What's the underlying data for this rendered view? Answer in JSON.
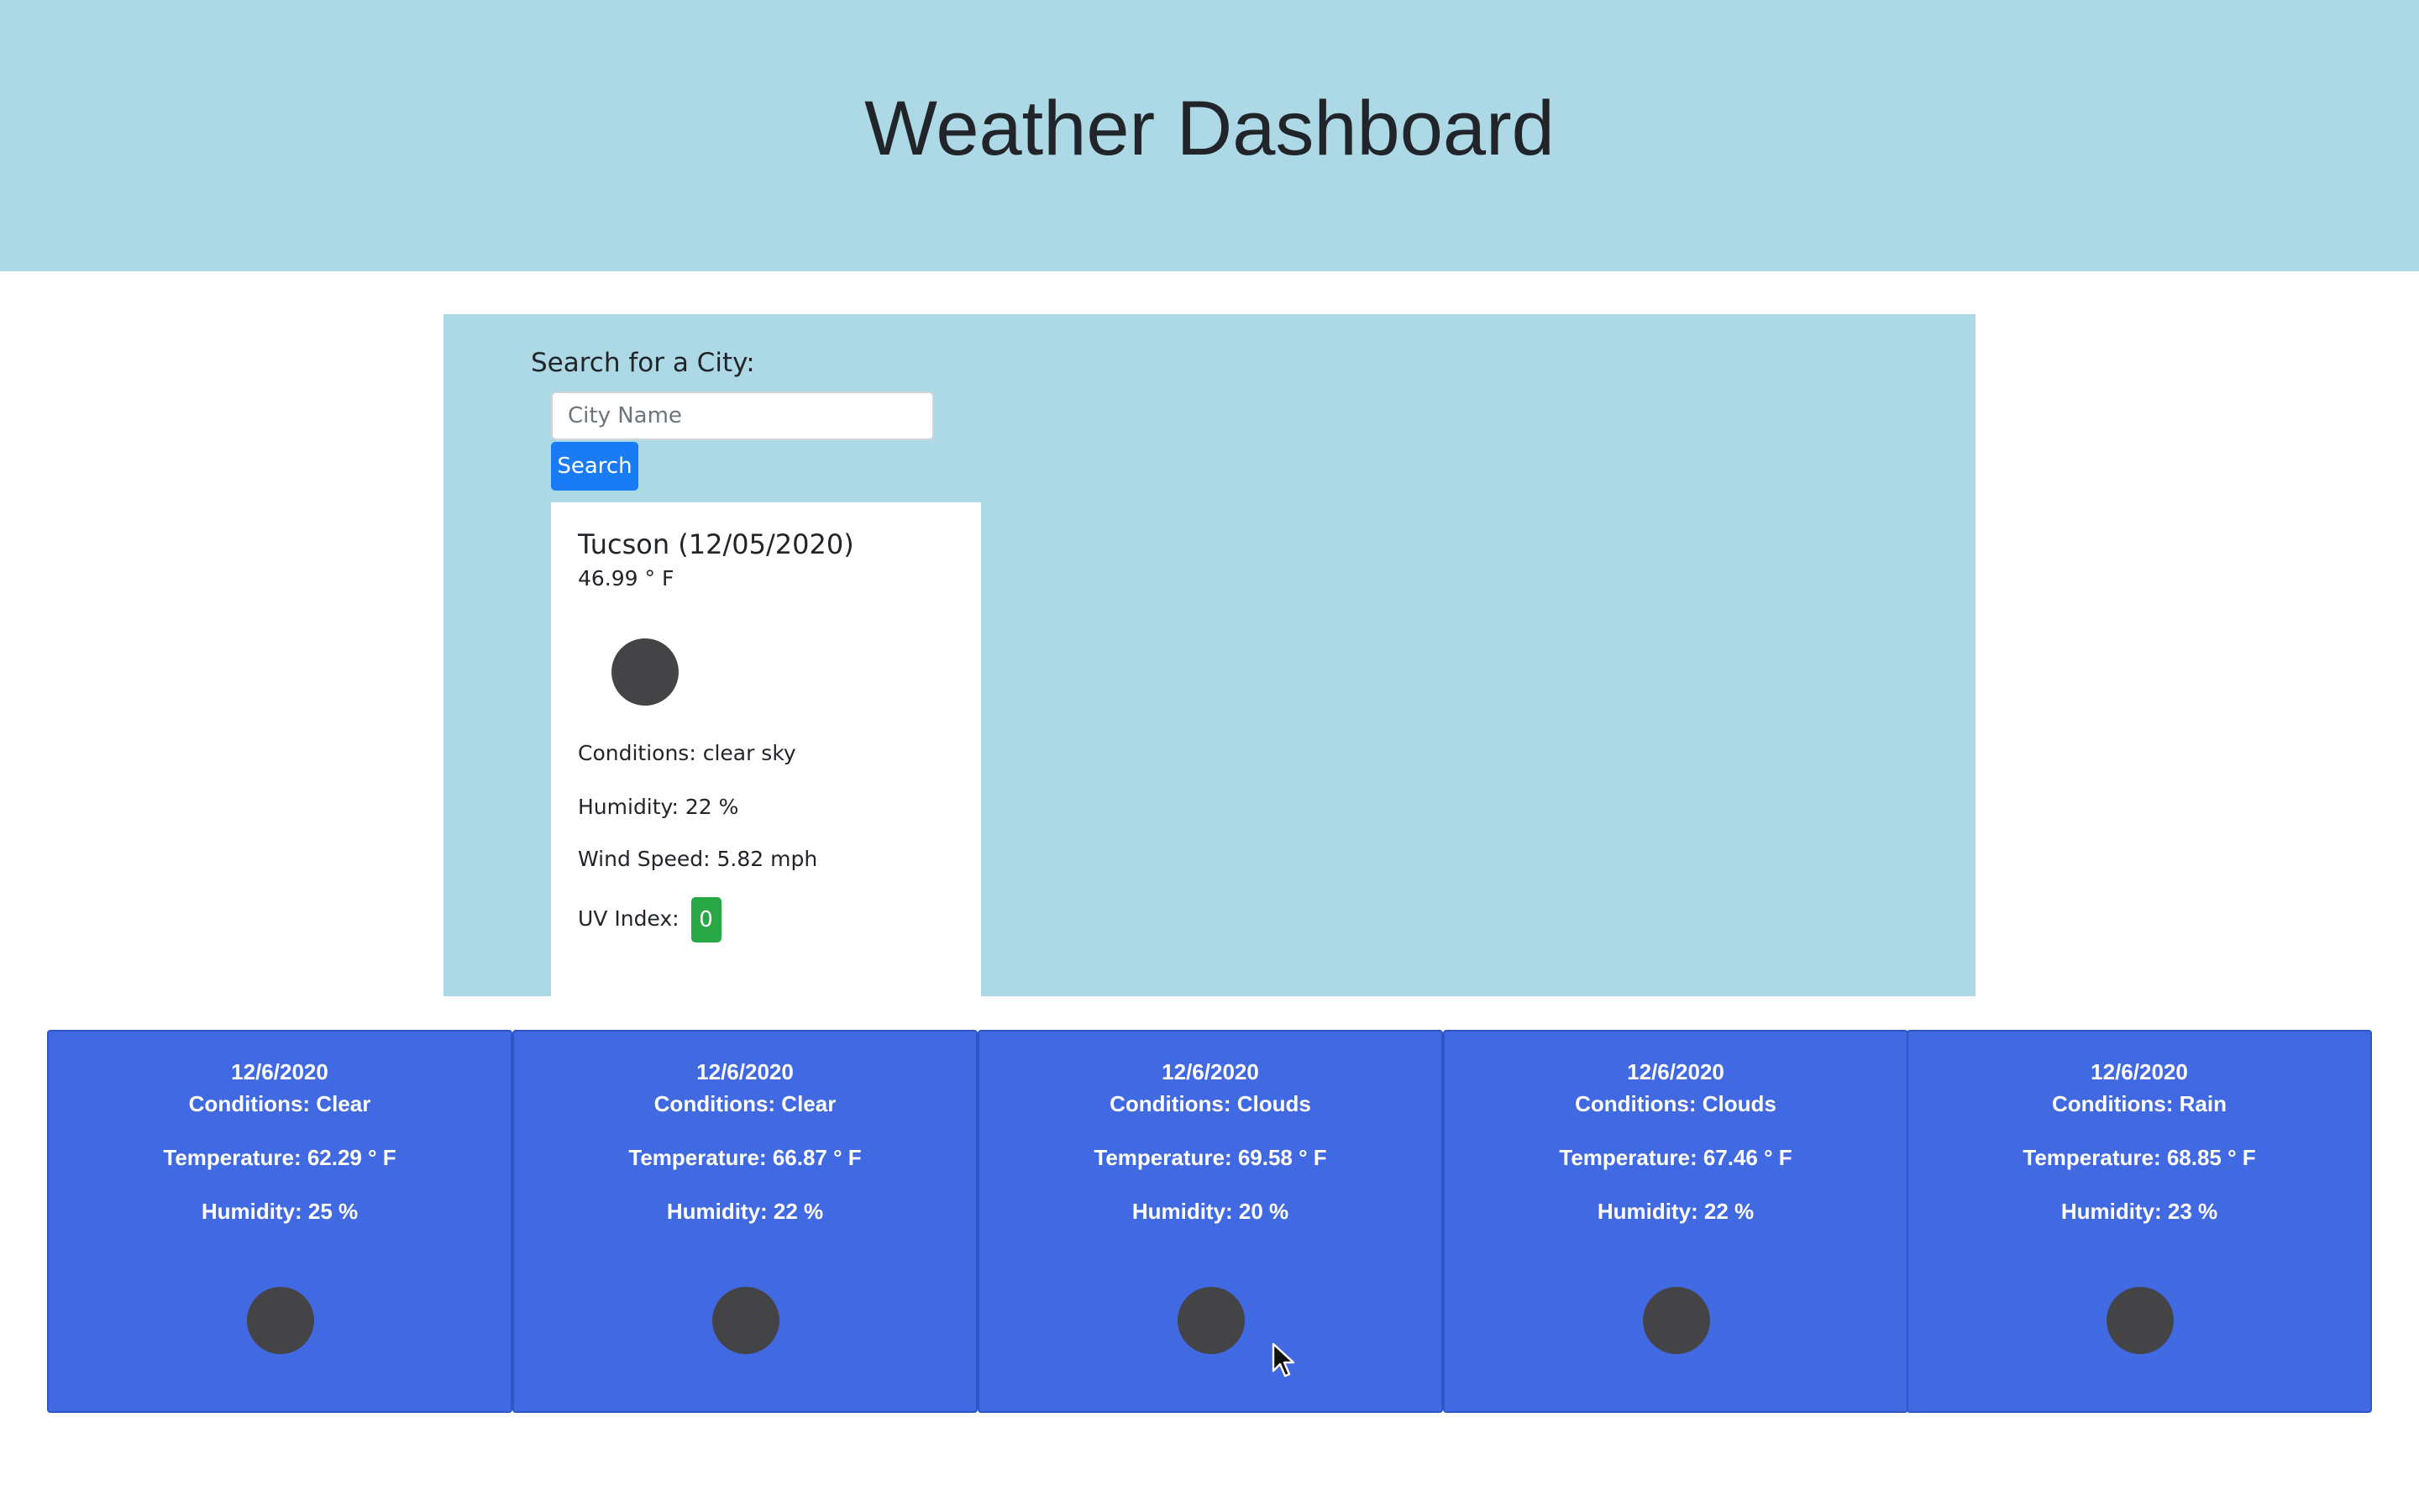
{
  "header": {
    "title": "Weather Dashboard",
    "background": "#add8e6"
  },
  "search": {
    "label": "Search for a City:",
    "input_value": "",
    "input_placeholder": "City Name",
    "button_label": "Search",
    "button_color": "#1a7cf5"
  },
  "current": {
    "city_date": "Tucson (12/05/2020)",
    "temperature": "46.99 ° F",
    "icon": "weather-icon",
    "conditions": "Conditions: clear sky",
    "humidity": "Humidity: 22 %",
    "wind": "Wind Speed: 5.82 mph",
    "uv_label": "UV Index:",
    "uv_value": "0",
    "uv_color": "#28a745"
  },
  "forecast": {
    "card_color": "#4169e1",
    "days": [
      {
        "date": "12/6/2020",
        "conditions": "Conditions: Clear",
        "temperature": "Temperature: 62.29 ° F",
        "humidity": "Humidity: 25 %",
        "icon": "weather-icon"
      },
      {
        "date": "12/6/2020",
        "conditions": "Conditions: Clear",
        "temperature": "Temperature: 66.87 ° F",
        "humidity": "Humidity: 22 %",
        "icon": "weather-icon"
      },
      {
        "date": "12/6/2020",
        "conditions": "Conditions: Clouds",
        "temperature": "Temperature: 69.58 ° F",
        "humidity": "Humidity: 20 %",
        "icon": "weather-icon"
      },
      {
        "date": "12/6/2020",
        "conditions": "Conditions: Clouds",
        "temperature": "Temperature: 67.46 ° F",
        "humidity": "Humidity: 22 %",
        "icon": "weather-icon"
      },
      {
        "date": "12/6/2020",
        "conditions": "Conditions: Rain",
        "temperature": "Temperature: 68.85 ° F",
        "humidity": "Humidity: 23 %",
        "icon": "weather-icon"
      }
    ]
  }
}
